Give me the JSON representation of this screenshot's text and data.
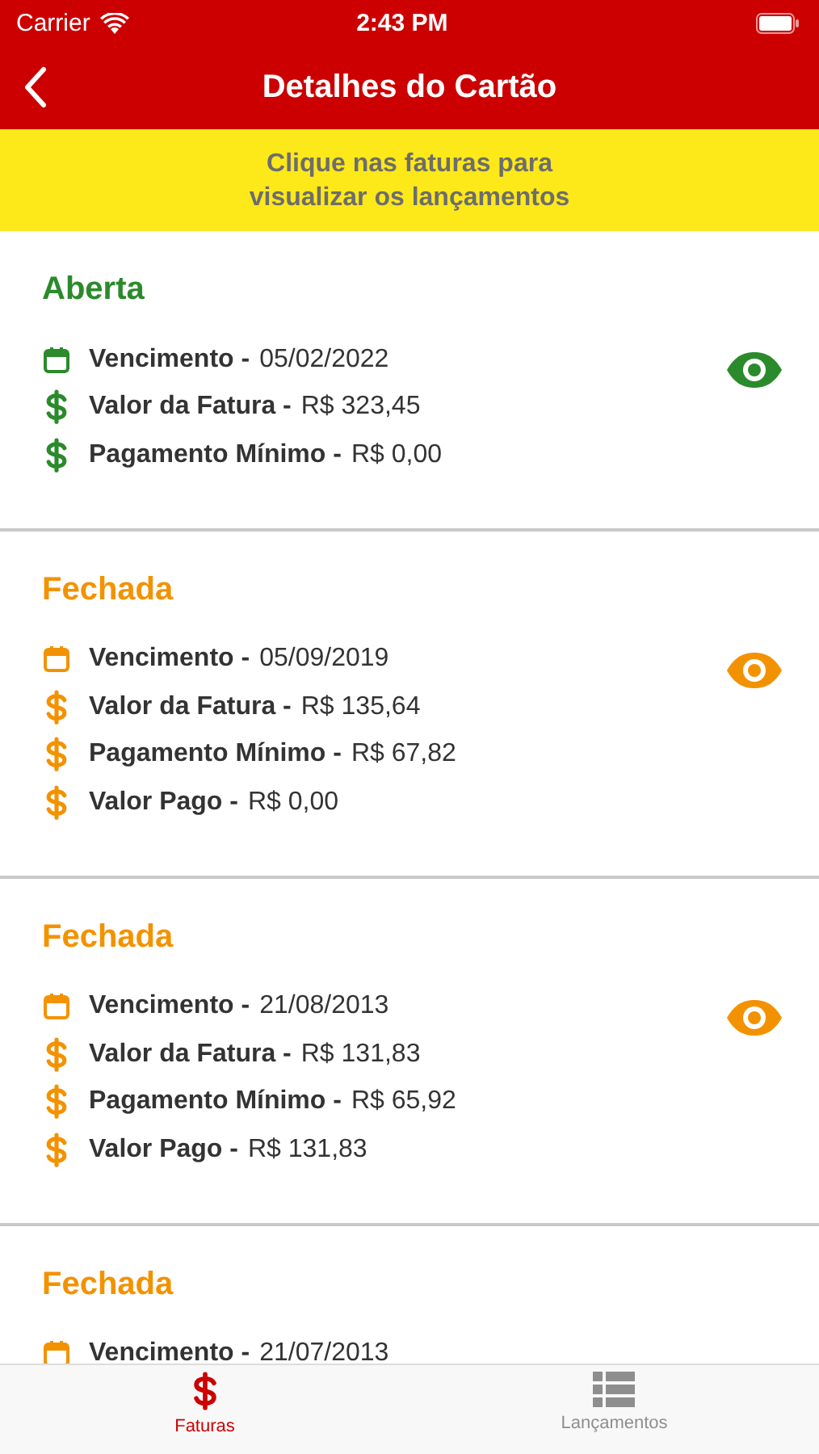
{
  "status_bar": {
    "carrier": "Carrier",
    "time": "2:43 PM"
  },
  "nav_bar": {
    "title": "Detalhes do Cartão"
  },
  "banner": {
    "lines": [
      "Clique nas faturas para",
      "visualizar os lançamentos"
    ]
  },
  "invoices": [
    {
      "status": "Aberta",
      "kind": "open",
      "view_icon": true,
      "fields": [
        {
          "kind": "date",
          "label": "Vencimento -",
          "value": "05/02/2022"
        },
        {
          "kind": "amount",
          "label": "Valor da Fatura -",
          "value": "R$ 323,45"
        },
        {
          "kind": "amount",
          "label": "Pagamento Mínimo -",
          "value": "R$ 0,00"
        }
      ]
    },
    {
      "status": "Fechada",
      "kind": "closed",
      "view_icon": true,
      "fields": [
        {
          "kind": "date",
          "label": "Vencimento -",
          "value": "05/09/2019"
        },
        {
          "kind": "amount",
          "label": "Valor da Fatura -",
          "value": "R$ 135,64"
        },
        {
          "kind": "amount",
          "label": "Pagamento Mínimo -",
          "value": "R$ 67,82"
        },
        {
          "kind": "amount",
          "label": "Valor Pago -",
          "value": "R$ 0,00"
        }
      ]
    },
    {
      "status": "Fechada",
      "kind": "closed",
      "view_icon": true,
      "fields": [
        {
          "kind": "date",
          "label": "Vencimento -",
          "value": "21/08/2013"
        },
        {
          "kind": "amount",
          "label": "Valor da Fatura -",
          "value": "R$ 131,83"
        },
        {
          "kind": "amount",
          "label": "Pagamento Mínimo -",
          "value": "R$ 65,92"
        },
        {
          "kind": "amount",
          "label": "Valor Pago -",
          "value": "R$ 131,83"
        }
      ]
    },
    {
      "status": "Fechada",
      "kind": "closed",
      "fields": [
        {
          "kind": "date",
          "label": "Vencimento -",
          "value": "21/07/2013"
        }
      ]
    }
  ],
  "tab_bar": [
    {
      "label": "Faturas",
      "kind": "invoices",
      "selected": true
    },
    {
      "label": "Lançamentos",
      "kind": "entries",
      "selected": false
    }
  ]
}
